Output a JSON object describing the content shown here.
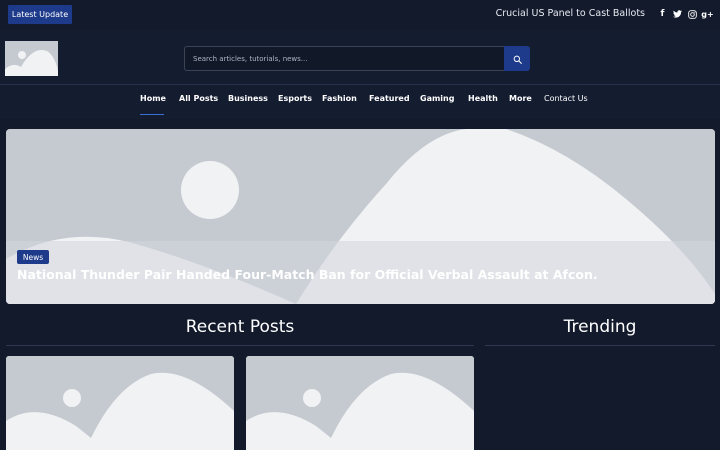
{
  "topbar": {
    "latest_label": "Latest Update",
    "ticker_text": "Crucial US Panel to Cast Ballots",
    "socials": [
      "f",
      "t",
      "ig",
      "g+"
    ]
  },
  "header": {
    "search": {
      "placeholder": "Search articles, tutorials, news..."
    }
  },
  "nav": {
    "items": [
      "Home",
      "All Posts",
      "Business",
      "Esports",
      "Fashion",
      "Featured",
      "Gaming",
      "Health",
      "More",
      "Contact Us"
    ],
    "active": "Home"
  },
  "hero": {
    "badge": "News",
    "title": "National Thunder Pair Handed Four-Match Ban for Official Verbal Assault at Afcon."
  },
  "sections": {
    "recent_title": "Recent Posts",
    "trending_title": "Trending"
  },
  "colors": {
    "background": "#121a2c",
    "accent": "#1e3a8a",
    "placeholder": "#c5cad1"
  }
}
